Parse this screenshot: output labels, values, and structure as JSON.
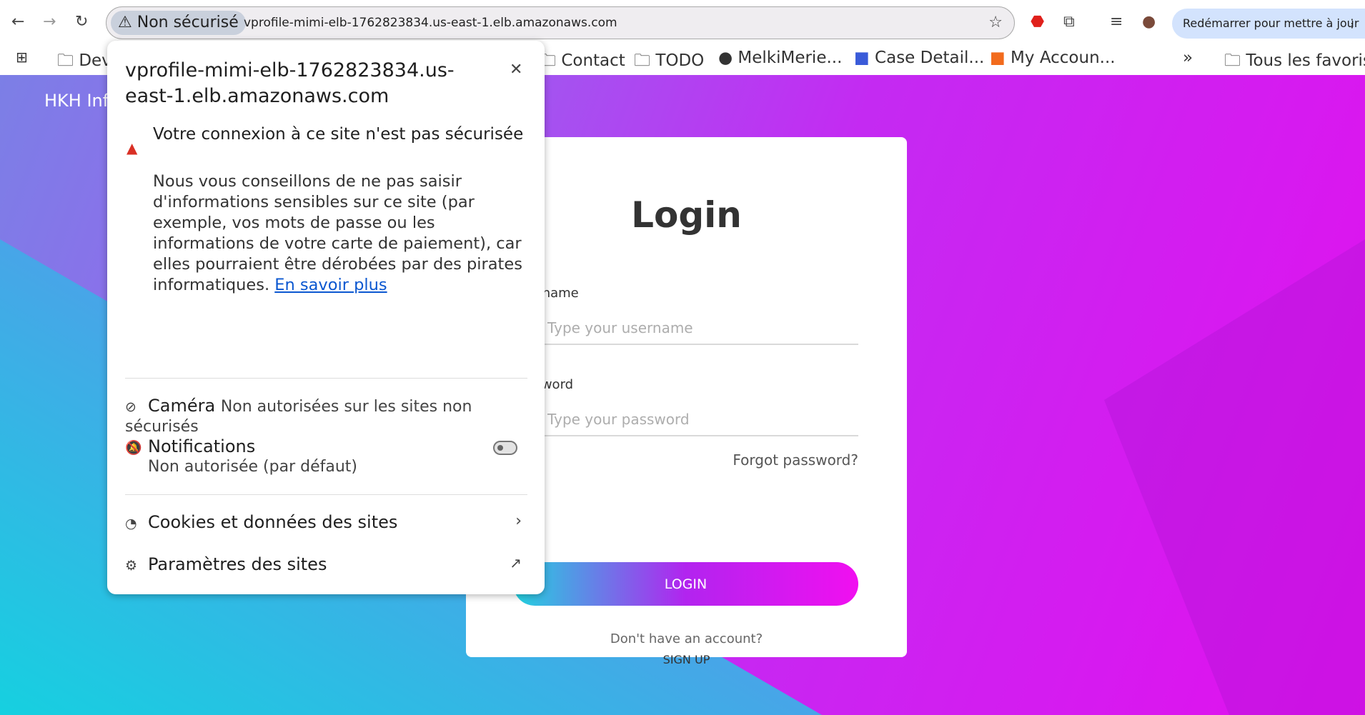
{
  "browser": {
    "security_chip": "Non sécurisé",
    "url": "vprofile-mimi-elb-1762823834.us-east-1.elb.amazonaws.com",
    "update_button": "Redémarrer pour mettre à jour"
  },
  "bookmarks": [
    {
      "label": "Dev"
    },
    {
      "label": "Contact"
    },
    {
      "label": "TODO"
    },
    {
      "label": "MelkiMerie..."
    },
    {
      "label": "Case Detail..."
    },
    {
      "label": "My Accoun..."
    }
  ],
  "bookmarks_overflow": "»",
  "all_bookmarks": "Tous les favoris",
  "page": {
    "brand": "HKH Info",
    "title": "Login",
    "username_label": "Username",
    "username_placeholder": "Type your username",
    "password_label": "Password",
    "password_placeholder": "Type your password",
    "forgot": "Forgot password?",
    "login_button": "LOGIN",
    "no_account": "Don't have an account?",
    "signup": "SIGN UP"
  },
  "popup": {
    "title": "vprofile-mimi-elb-1762823834.us-east-1.elb.amazonaws.com",
    "heading": "Votre connexion à ce site n'est pas sécurisée",
    "body": "Nous vous conseillons de ne pas saisir d'informations sensibles sur ce site (par exemple, vos mots de passe ou les informations de votre carte de paiement), car elles pourraient être dérobées par des pirates informatiques.",
    "learn_more": "En savoir plus",
    "camera_label": "Caméra",
    "camera_status": "Non autorisées sur les sites non sécurisés",
    "notif_label": "Notifications",
    "notif_status": "Non autorisée (par défaut)",
    "notif_enabled": false,
    "cookies": "Cookies et données des sites",
    "site_settings": "Paramètres des sites"
  }
}
